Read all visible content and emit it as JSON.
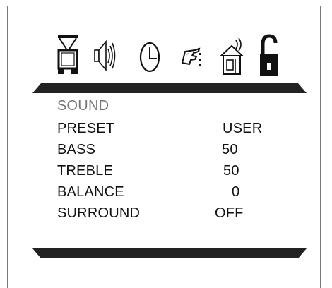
{
  "toolbar": {
    "icons": [
      {
        "name": "tv-picture-icon"
      },
      {
        "name": "sound-speaker-icon"
      },
      {
        "name": "clock-timer-icon"
      },
      {
        "name": "hand-setup-icon"
      },
      {
        "name": "house-antenna-icon"
      },
      {
        "name": "padlock-unlocked-icon",
        "selected": true
      }
    ]
  },
  "menu": {
    "title": "SOUND",
    "rows": [
      {
        "label": "PRESET",
        "value": "USER"
      },
      {
        "label": "BASS",
        "value": "50"
      },
      {
        "label": "TREBLE",
        "value": "50"
      },
      {
        "label": "BALANCE",
        "value": "0"
      },
      {
        "label": "SURROUND",
        "value": "OFF"
      }
    ]
  },
  "colors": {
    "bar": "#222222",
    "title_text": "#777777",
    "text": "#111111",
    "frame": "#777777"
  }
}
